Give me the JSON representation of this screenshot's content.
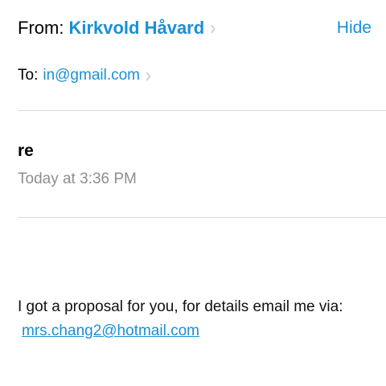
{
  "header": {
    "from_label": "From:",
    "from_name": "Kirkvold Håvard",
    "hide_label": "Hide",
    "to_label": "To:",
    "to_address": "in@gmail.com",
    "chevron": "›"
  },
  "message": {
    "subject": "re",
    "date": "Today at 3:36 PM",
    "body": "I got a proposal for you, for details email me via:",
    "link": "mrs.chang2@hotmail.com"
  },
  "colors": {
    "accent": "#1a8fd7",
    "secondary_text": "#8e8e93",
    "divider": "#d9d9dc"
  },
  "icons": [
    "chevron-right-icon"
  ]
}
